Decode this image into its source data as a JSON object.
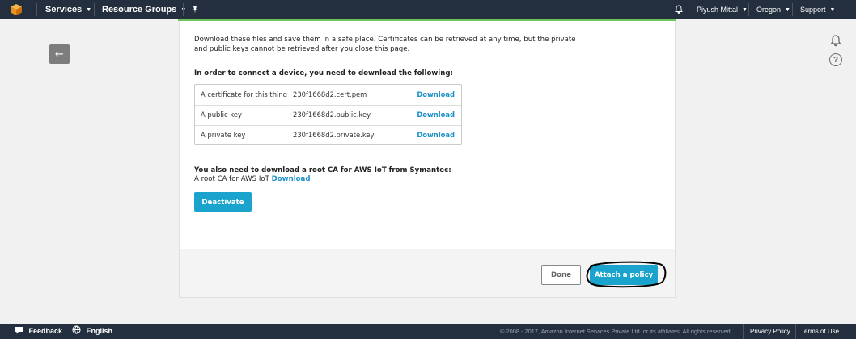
{
  "nav": {
    "services": "Services",
    "resource_groups": "Resource Groups",
    "user": "Piyush Mittal",
    "region": "Oregon",
    "support": "Support"
  },
  "panel": {
    "intro_line1": "Download these files and save them in a safe place. Certificates can be retrieved at any time, but the private",
    "intro_line2": "and public keys cannot be retrieved after you close this page.",
    "connect_heading": "In order to connect a device, you need to download the following:",
    "files": [
      {
        "desc": "A certificate for this thing",
        "file": "230f1668d2.cert.pem",
        "action": "Download"
      },
      {
        "desc": "A public key",
        "file": "230f1668d2.public.key",
        "action": "Download"
      },
      {
        "desc": "A private key",
        "file": "230f1668d2.private.key",
        "action": "Download"
      }
    ],
    "root_ca_heading": "You also need to download a root CA for AWS IoT from Symantec:",
    "root_ca_text": "A root CA for AWS IoT",
    "root_ca_link": "Download",
    "deactivate": "Deactivate",
    "done": "Done",
    "attach_policy": "Attach a policy"
  },
  "footer": {
    "feedback": "Feedback",
    "language": "English",
    "copyright": "© 2008 - 2017, Amazon Internet Services Private Ltd. or its affiliates. All rights reserved.",
    "privacy": "Privacy Policy",
    "terms": "Terms of Use"
  },
  "colors": {
    "nav_bg": "#232f3e",
    "accent": "#1aa3cc",
    "link": "#1a8fc8",
    "success_line": "#6fc35b"
  }
}
